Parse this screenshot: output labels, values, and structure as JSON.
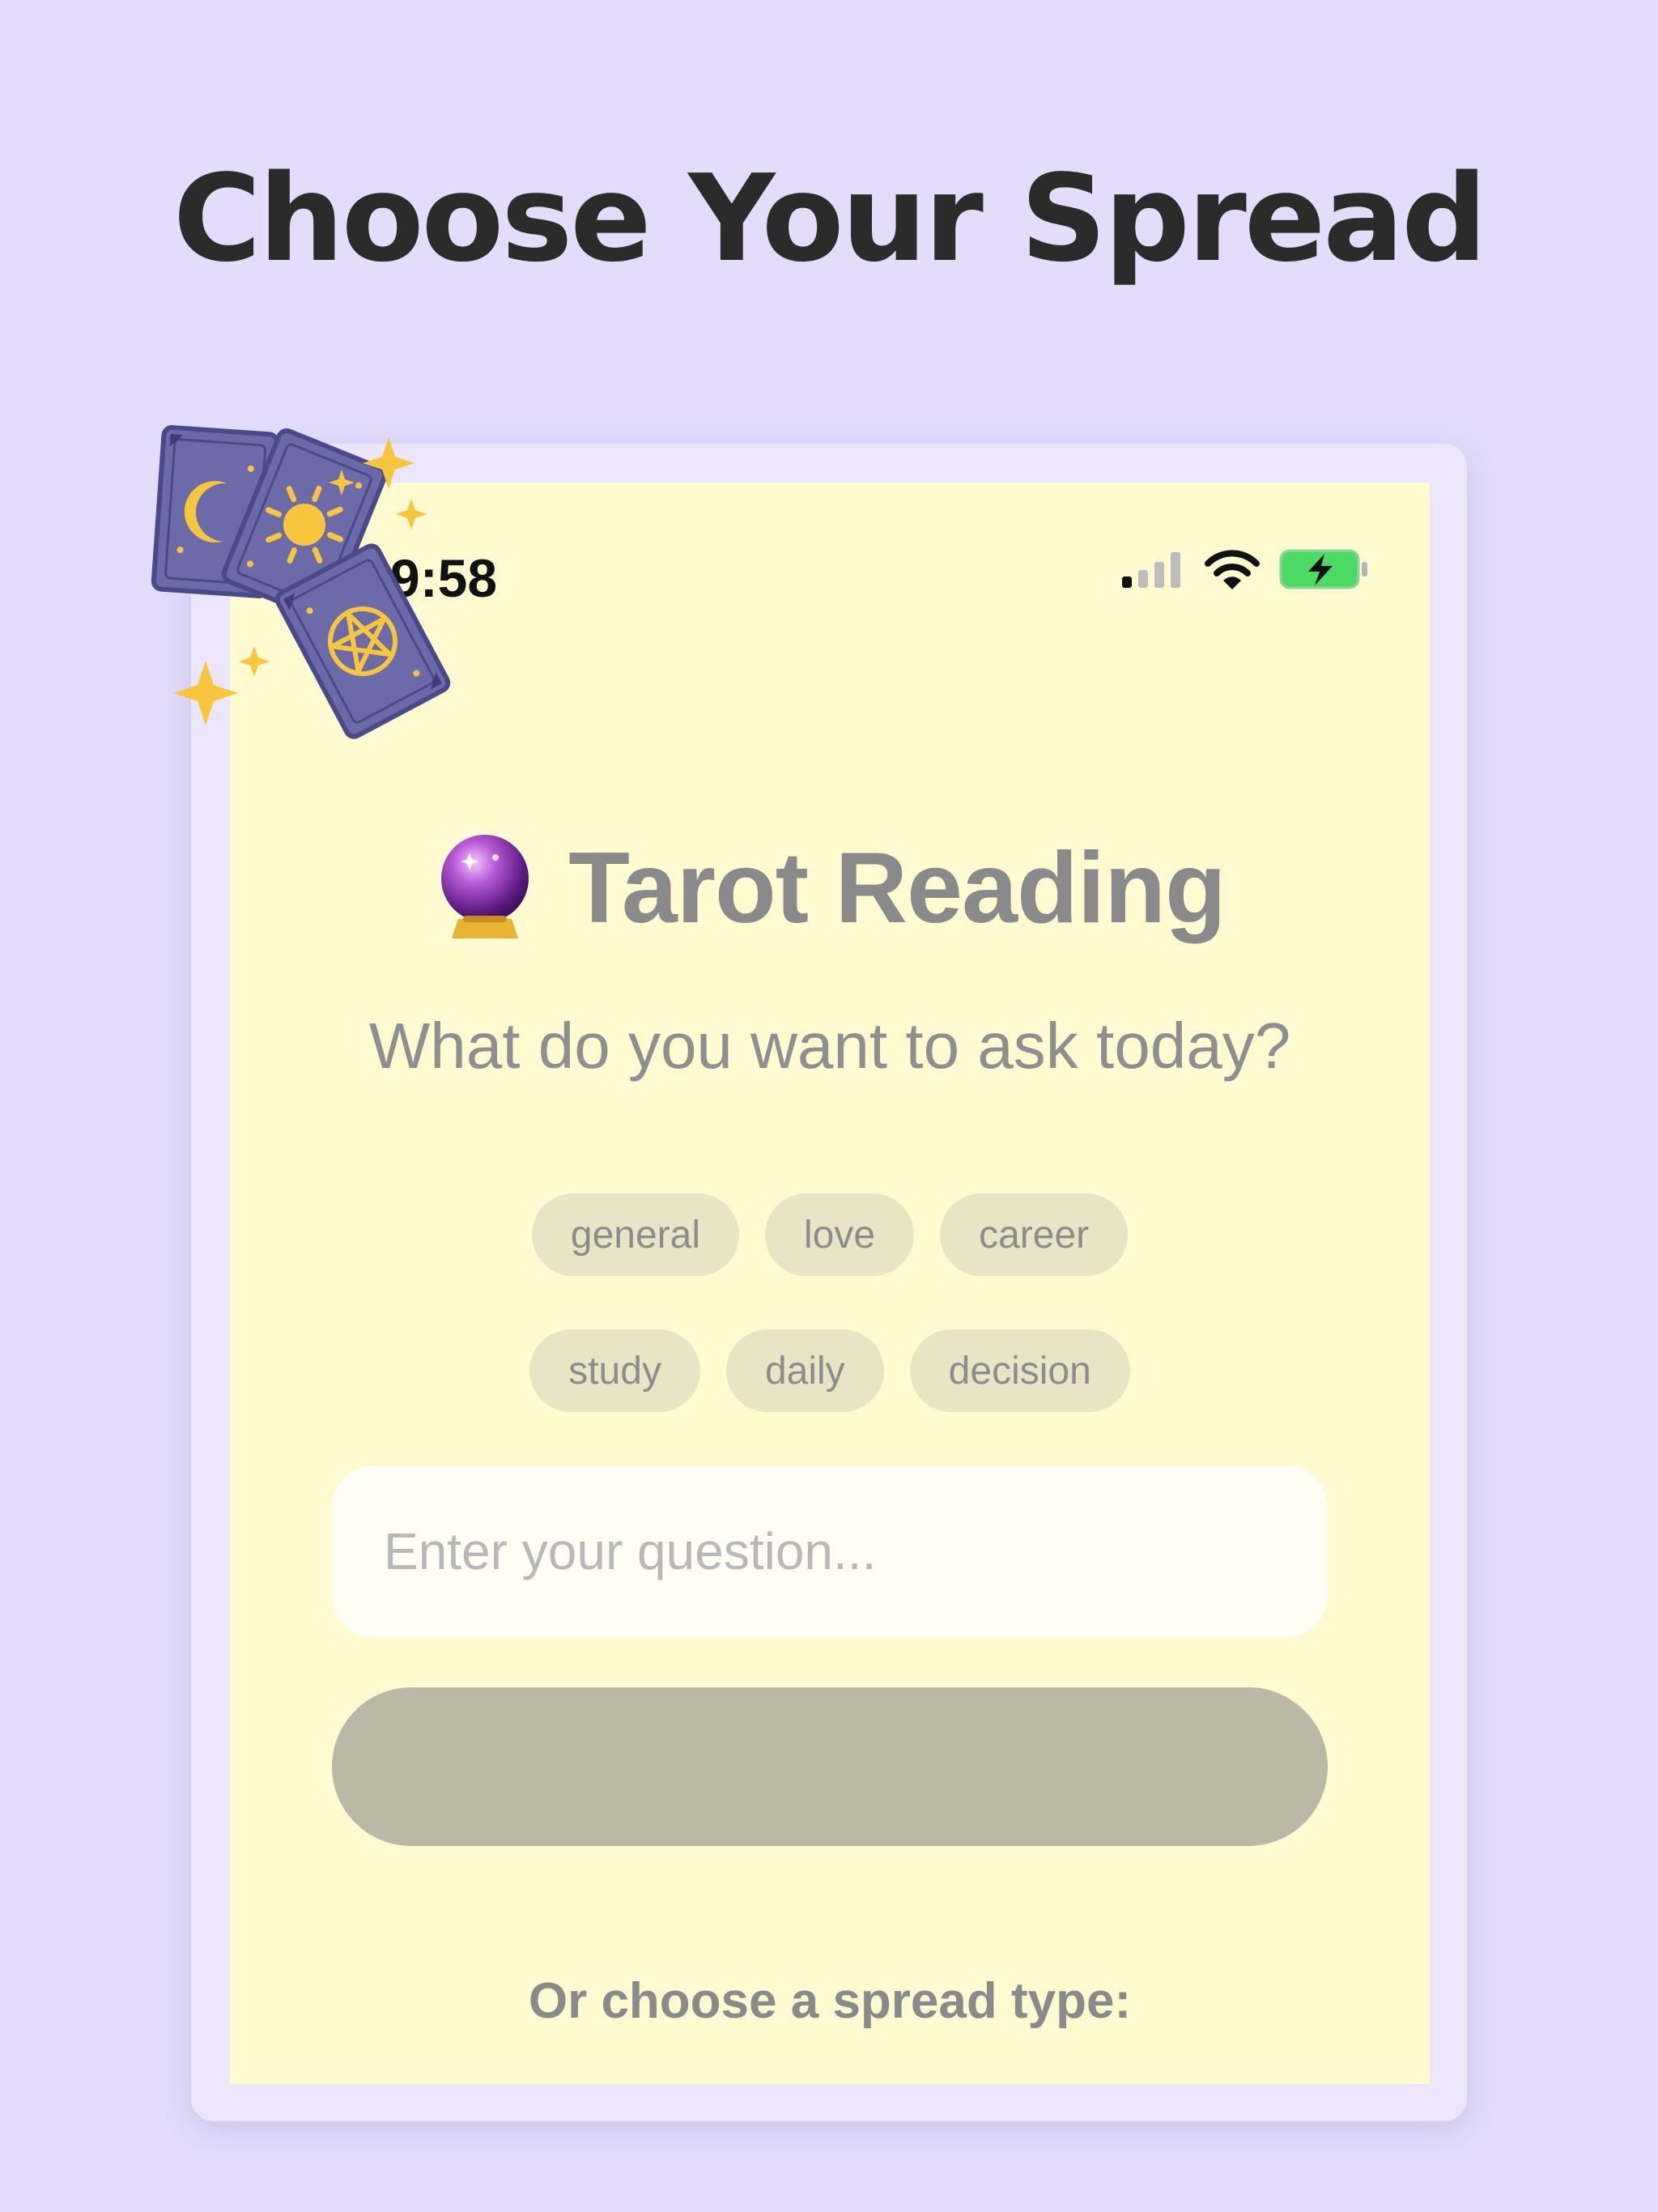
{
  "headline": "Choose Your Spread",
  "status_bar": {
    "time": "9:58"
  },
  "app": {
    "title_icon": "crystal-ball-icon",
    "title": "Tarot Reading",
    "subtitle": "What do you want to ask today?",
    "topic_chips": [
      [
        "general",
        "love",
        "career"
      ],
      [
        "study",
        "daily",
        "decision"
      ]
    ],
    "question_input": {
      "value": "",
      "placeholder": "Enter your question..."
    },
    "submit_button_label": "",
    "spread_prompt": "Or choose a spread type:"
  },
  "colors": {
    "page_background": "#e3ddfb",
    "screen_background": "#fffad0",
    "card_color": "#6c6aa8",
    "star_color": "#f7c63c",
    "battery_color": "#4cd964"
  }
}
